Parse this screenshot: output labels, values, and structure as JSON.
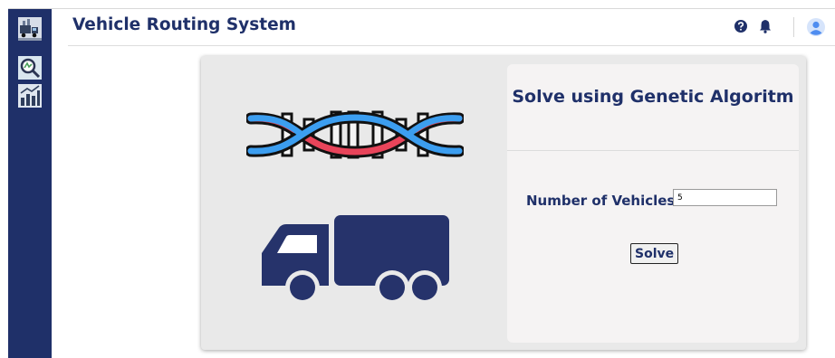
{
  "header": {
    "title": "Vehicle Routing System",
    "icons": [
      "help-icon",
      "bell-icon",
      "user-avatar-icon"
    ]
  },
  "sidebar": {
    "icons": [
      "truck-logo-icon",
      "route-search-icon",
      "analytics-chart-icon"
    ]
  },
  "main": {
    "illustrations": [
      "dna-icon",
      "truck-icon"
    ],
    "panel": {
      "title": "Solve using Genetic Algoritm",
      "vehicles_label": "Number of Vehicles:",
      "vehicles_value": "5",
      "solve_label": "Solve"
    }
  },
  "colors": {
    "brand_navy": "#1f3069",
    "dna_red": "#e8445a",
    "dna_blue": "#3c9ef0",
    "avatar_blue": "#4f8df0"
  }
}
